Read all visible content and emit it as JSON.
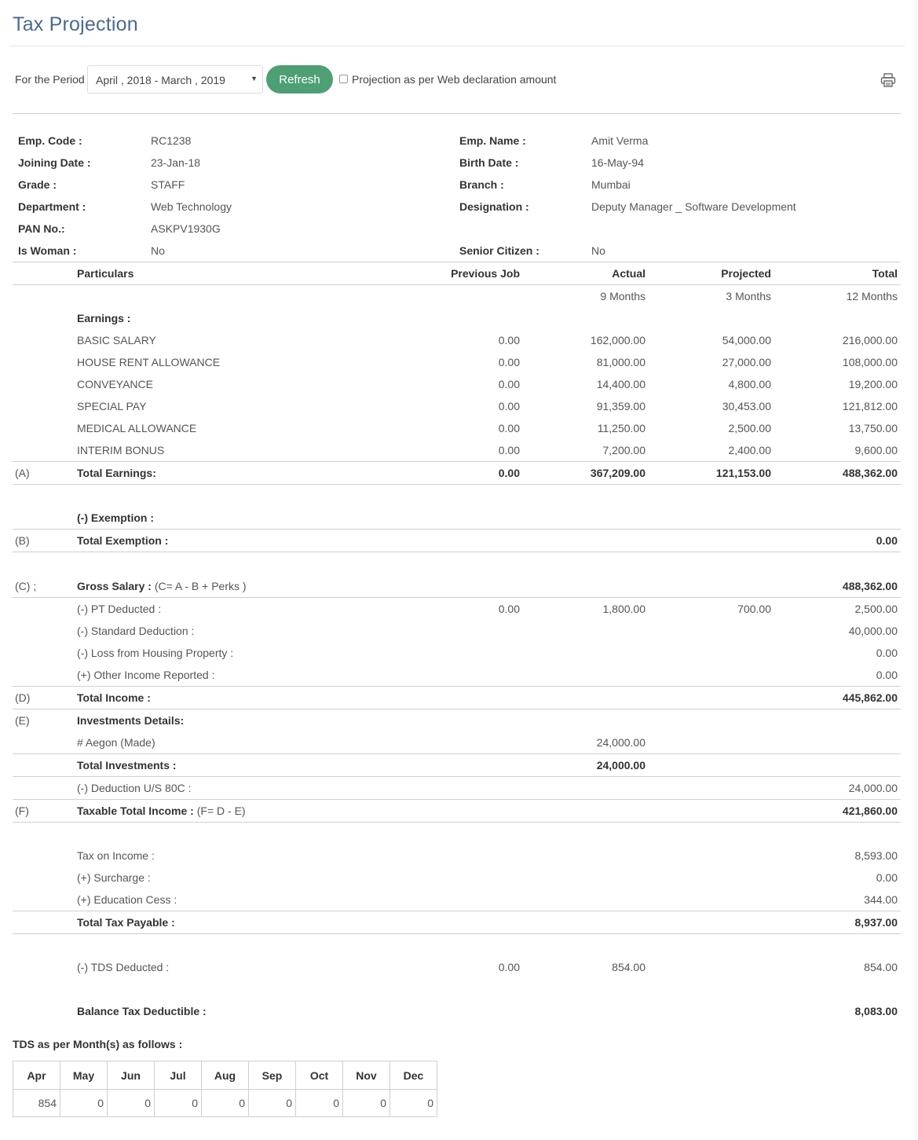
{
  "page": {
    "title": "Tax Projection"
  },
  "filter": {
    "period_label": "For the Period",
    "period_value": "April , 2018 - March , 2019",
    "refresh_label": "Refresh",
    "projection_label": "Projection as per Web declaration amount",
    "projection_checked": false
  },
  "employee": {
    "left": [
      {
        "label": "Emp. Code :",
        "value": "RC1238"
      },
      {
        "label": "Joining Date :",
        "value": "23-Jan-18"
      },
      {
        "label": "Grade :",
        "value": "STAFF"
      },
      {
        "label": "Department :",
        "value": "Web Technology"
      },
      {
        "label": "PAN No.:",
        "value": "ASKPV1930G"
      },
      {
        "label": "Is Woman :",
        "value": "No"
      }
    ],
    "right": [
      {
        "label": "Emp. Name :",
        "value": "Amit Verma"
      },
      {
        "label": "Birth Date :",
        "value": "16-May-94"
      },
      {
        "label": "Branch :",
        "value": "Mumbai"
      },
      {
        "label": "Designation :",
        "value": "Deputy Manager _ Software Development"
      },
      {
        "label": "Senior Citizen :",
        "value": "No"
      }
    ]
  },
  "table": {
    "headers": {
      "particulars": "Particulars",
      "previous": "Previous Job",
      "actual": "Actual",
      "projected": "Projected",
      "total": "Total"
    },
    "months": {
      "actual": "9 Months",
      "projected": "3 Months",
      "total": "12 Months"
    },
    "earnings_label": "Earnings :",
    "earnings": [
      {
        "name": "BASIC SALARY",
        "previous": "0.00",
        "actual": "162,000.00",
        "projected": "54,000.00",
        "total": "216,000.00"
      },
      {
        "name": "HOUSE RENT ALLOWANCE",
        "previous": "0.00",
        "actual": "81,000.00",
        "projected": "27,000.00",
        "total": "108,000.00"
      },
      {
        "name": "CONVEYANCE",
        "previous": "0.00",
        "actual": "14,400.00",
        "projected": "4,800.00",
        "total": "19,200.00"
      },
      {
        "name": "SPECIAL PAY",
        "previous": "0.00",
        "actual": "91,359.00",
        "projected": "30,453.00",
        "total": "121,812.00"
      },
      {
        "name": "MEDICAL ALLOWANCE",
        "previous": "0.00",
        "actual": "11,250.00",
        "projected": "2,500.00",
        "total": "13,750.00"
      },
      {
        "name": "INTERIM BONUS",
        "previous": "0.00",
        "actual": "7,200.00",
        "projected": "2,400.00",
        "total": "9,600.00"
      }
    ],
    "total_earnings": {
      "letter": "(A)",
      "label": "Total Earnings:",
      "previous": "0.00",
      "actual": "367,209.00",
      "projected": "121,153.00",
      "total": "488,362.00"
    },
    "exemption_label": "(-) Exemption :",
    "total_exemption": {
      "letter": "(B)",
      "label": "Total Exemption :",
      "total": "0.00"
    },
    "gross": {
      "letter": "(C) ;",
      "label_bold": "Gross Salary :",
      "label_normal": " (C= A - B + Perks )",
      "total": "488,362.00"
    },
    "pt": {
      "label": "(-) PT Deducted :",
      "previous": "0.00",
      "actual": "1,800.00",
      "projected": "700.00",
      "total": "2,500.00"
    },
    "standard": {
      "label": "(-) Standard Deduction :",
      "total": "40,000.00"
    },
    "housing": {
      "label": "(-) Loss from Housing Property :",
      "total": "0.00"
    },
    "other_income": {
      "label": "(+) Other Income Reported :",
      "total": "0.00"
    },
    "total_income": {
      "letter": "(D)",
      "label": "Total Income :",
      "total": "445,862.00"
    },
    "investments": {
      "letter": "(E)",
      "label": "Investments Details:"
    },
    "aegon": {
      "label": "# Aegon (Made)",
      "actual": "24,000.00"
    },
    "total_investments": {
      "label": "Total Investments :",
      "actual": "24,000.00"
    },
    "deduction_80c": {
      "label": "(-) Deduction U/S 80C :",
      "total": "24,000.00"
    },
    "taxable": {
      "letter": "(F)",
      "label_bold": "Taxable Total Income :",
      "label_normal": " (F= D - E)",
      "total": "421,860.00"
    },
    "tax_on_income": {
      "label": "Tax on Income :",
      "total": "8,593.00"
    },
    "surcharge": {
      "label": "(+) Surcharge :",
      "total": "0.00"
    },
    "cess": {
      "label": "(+) Education Cess :",
      "total": "344.00"
    },
    "total_tax": {
      "label": "Total Tax Payable :",
      "total": "8,937.00"
    },
    "tds": {
      "label": "(-) TDS Deducted :",
      "previous": "0.00",
      "actual": "854.00",
      "total": "854.00"
    },
    "balance": {
      "label": "Balance Tax Deductible :",
      "total": "8,083.00"
    }
  },
  "tds_monthly": {
    "title": "TDS as per Month(s) as follows :",
    "months": [
      "Apr",
      "May",
      "Jun",
      "Jul",
      "Aug",
      "Sep",
      "Oct",
      "Nov",
      "Dec"
    ],
    "values": [
      "854",
      "0",
      "0",
      "0",
      "0",
      "0",
      "0",
      "0",
      "0"
    ]
  },
  "colors": {
    "title": "#4a6a8f",
    "refresh_button": "#4e9f73"
  },
  "icons": {
    "print": "printer-icon",
    "dropdown": "caret-down-icon"
  }
}
